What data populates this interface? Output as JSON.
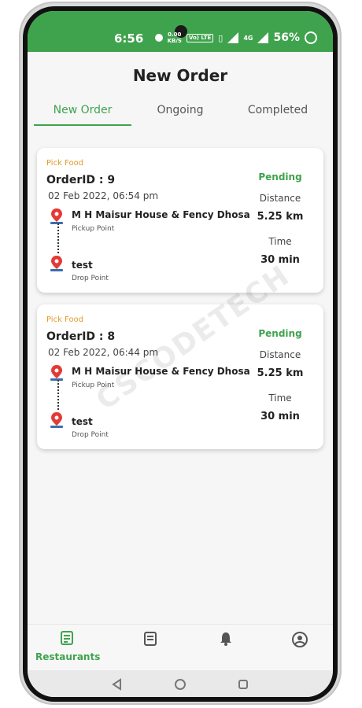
{
  "status_bar": {
    "time": "6:56",
    "speed": "0.00",
    "speed_unit": "KB/S",
    "volte": "Vo) LTE",
    "network": "4G",
    "battery": "56%"
  },
  "header": {
    "title": "New Order"
  },
  "tabs": [
    {
      "label": "New Order",
      "active": true
    },
    {
      "label": "Ongoing",
      "active": false
    },
    {
      "label": "Completed",
      "active": false
    }
  ],
  "orders": [
    {
      "tag": "Pick Food",
      "order_id": "OrderID : 9",
      "datetime": "02 Feb 2022, 06:54 pm",
      "pickup_name": "M H Maisur House & Fency Dhosa",
      "pickup_label": "Pickup Point",
      "drop_name": "test",
      "drop_label": "Drop Point",
      "status": "Pending",
      "distance_label": "Distance",
      "distance": "5.25 km",
      "time_label": "Time",
      "time": "30 min"
    },
    {
      "tag": "Pick Food",
      "order_id": "OrderID : 8",
      "datetime": "02 Feb 2022, 06:44 pm",
      "pickup_name": "M H Maisur House & Fency Dhosa",
      "pickup_label": "Pickup Point",
      "drop_name": "test",
      "drop_label": "Drop Point",
      "status": "Pending",
      "distance_label": "Distance",
      "distance": "5.25 km",
      "time_label": "Time",
      "time": "30 min"
    }
  ],
  "watermark": "CSCODETECH",
  "bottom_nav": [
    {
      "label": "Restaurants",
      "icon": "restaurant-list-icon",
      "active": true
    },
    {
      "label": "",
      "icon": "receipt-icon",
      "active": false
    },
    {
      "label": "",
      "icon": "bell-icon",
      "active": false
    },
    {
      "label": "",
      "icon": "profile-icon",
      "active": false
    }
  ],
  "colors": {
    "brand_green": "#3fa34d",
    "tag_orange": "#e49a2c"
  }
}
